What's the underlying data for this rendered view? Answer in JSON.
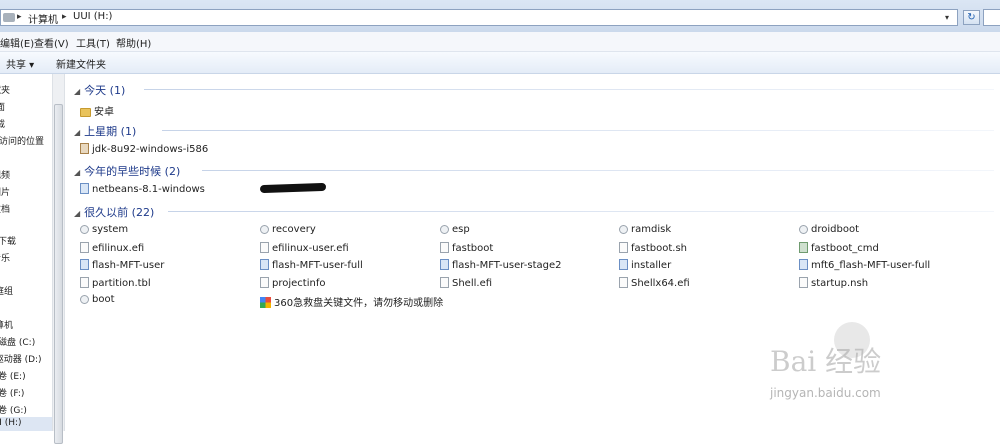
{
  "address": {
    "crumbs": [
      "计算机",
      "UUI (H:)"
    ],
    "sep": "▸",
    "dropdown": "▾",
    "refresh": "↻"
  },
  "menu": [
    "编辑(E)",
    "查看(V)",
    "工具(T)",
    "帮助(H)"
  ],
  "toolbar": {
    "share": "共享 ▾",
    "new_folder": "新建文件夹"
  },
  "nav": [
    "藏夹",
    "面",
    "载",
    "近访问的位置",
    "",
    "",
    "视频",
    "图片",
    "文档",
    "迅雷下载",
    "音乐",
    "",
    "家庭组",
    "",
    "计算机",
    "本地磁盘 (C:)",
    "DVD 驱动器 (D:)",
    "本地卷 (E:)",
    "本地卷 (F:)",
    "本地卷 (G:)",
    "UUI (H:)"
  ],
  "groups": [
    {
      "title": "今天 (1)",
      "items": [
        {
          "name": "安卓",
          "icon": "folder"
        }
      ]
    },
    {
      "title": "上星期 (1)",
      "items": [
        {
          "name": "jdk-8u92-windows-i586",
          "icon": "java"
        }
      ]
    },
    {
      "title": "今年的早些时候 (2)",
      "items": [
        {
          "name": "netbeans-8.1-windows",
          "icon": "exe"
        }
      ]
    },
    {
      "title": "很久以前 (22)",
      "items": [
        {
          "name": "system",
          "icon": "efi"
        },
        {
          "name": "recovery",
          "icon": "efi"
        },
        {
          "name": "esp",
          "icon": "efi"
        },
        {
          "name": "ramdisk",
          "icon": "efi"
        },
        {
          "name": "droidboot",
          "icon": "efi"
        },
        {
          "name": "efilinux.efi",
          "icon": "file"
        },
        {
          "name": "efilinux-user.efi",
          "icon": "file"
        },
        {
          "name": "fastboot",
          "icon": "file"
        },
        {
          "name": "fastboot.sh",
          "icon": "file"
        },
        {
          "name": "fastboot_cmd",
          "icon": "img"
        },
        {
          "name": "flash-MFT-user",
          "icon": "exe"
        },
        {
          "name": "flash-MFT-user-full",
          "icon": "exe"
        },
        {
          "name": "flash-MFT-user-stage2",
          "icon": "exe"
        },
        {
          "name": "installer",
          "icon": "exe"
        },
        {
          "name": "mft6_flash-MFT-user-full",
          "icon": "exe"
        },
        {
          "name": "partition.tbl",
          "icon": "file"
        },
        {
          "name": "projectinfo",
          "icon": "file"
        },
        {
          "name": "Shell.efi",
          "icon": "file"
        },
        {
          "name": "Shellx64.efi",
          "icon": "file"
        },
        {
          "name": "startup.nsh",
          "icon": "file"
        },
        {
          "name": "boot",
          "icon": "efi"
        },
        {
          "name": "360急救盘关键文件，请勿移动或删除",
          "icon": "warn"
        }
      ]
    }
  ],
  "watermark": {
    "brand": "Bai 经验",
    "url": "jingyan.baidu.com"
  }
}
